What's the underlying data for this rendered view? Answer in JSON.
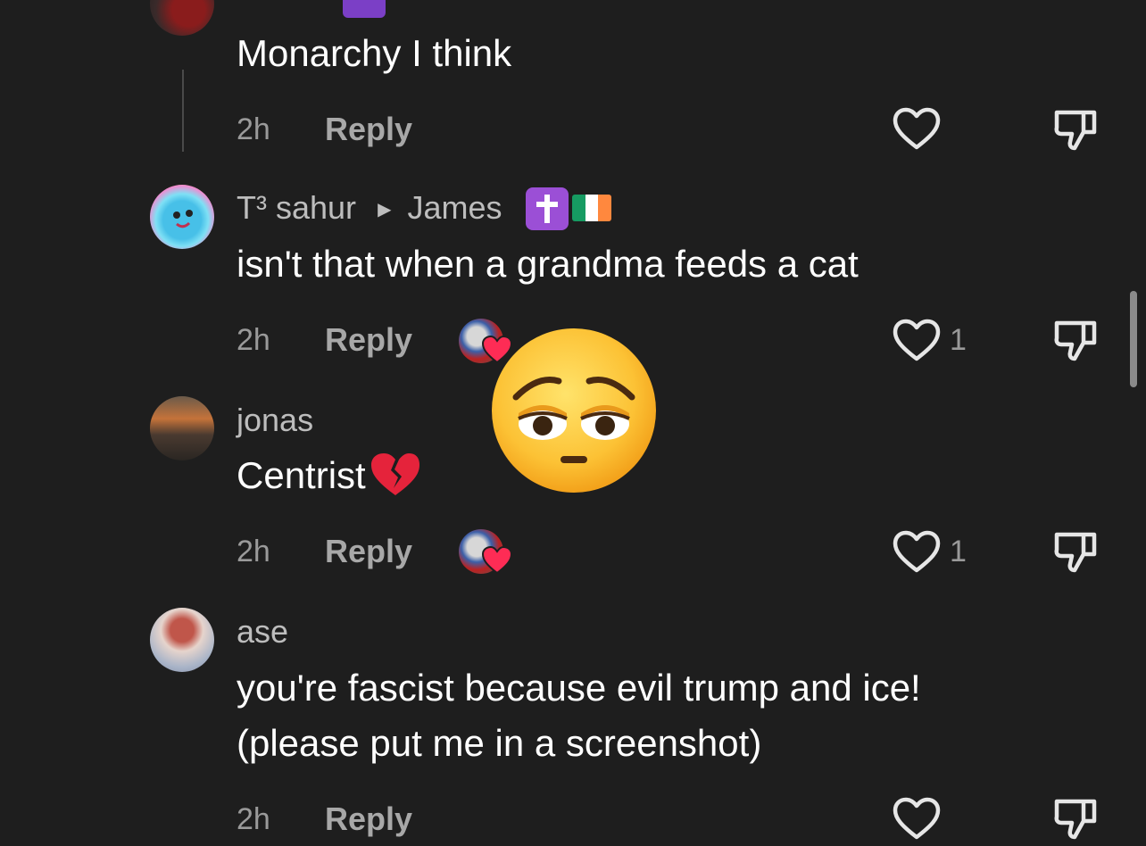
{
  "comments": [
    {
      "text": "Monarchy I think",
      "time": "2h",
      "reply_label": "Reply"
    },
    {
      "username": "T³ sahur",
      "reply_to": "James",
      "reply_to_badges": [
        "latin-cross-emoji",
        "ireland-flag-emoji"
      ],
      "text": "isn't that when a grandma feeds a cat",
      "time": "2h",
      "reply_label": "Reply",
      "like_count": "1",
      "creator_liked": true
    },
    {
      "username": "jonas",
      "text": "Centrist",
      "text_emoji": "broken-heart-emoji",
      "time": "2h",
      "reply_label": "Reply",
      "like_count": "1",
      "creator_liked": true
    },
    {
      "username": "ase",
      "text_line1": "you're fascist because evil trump and ice!",
      "text_line2": "(please put me in a screenshot)",
      "time": "2h",
      "reply_label": "Reply"
    }
  ],
  "overlay_sticker": "pensive-face-emoji",
  "colors": {
    "background": "#1e1e1e",
    "text": "#ffffff",
    "muted": "#9a9a9a",
    "heart_red": "#fe2c55"
  }
}
